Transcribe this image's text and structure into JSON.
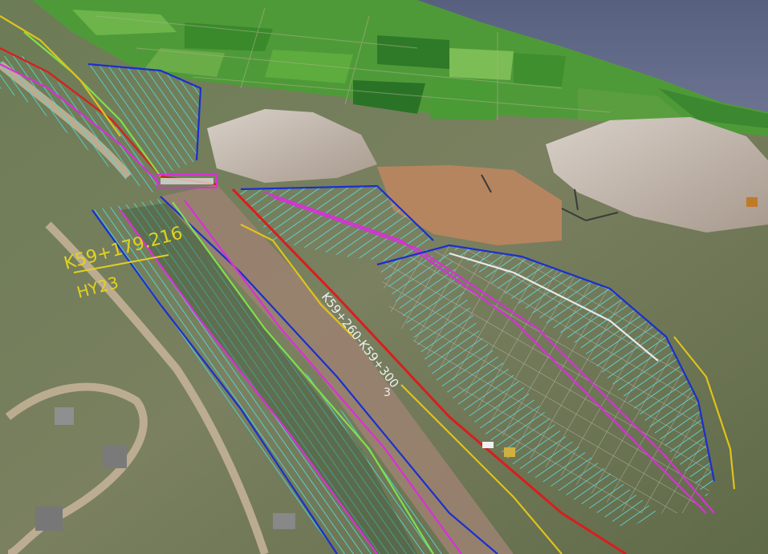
{
  "view": {
    "sky_color": "#5f6785",
    "farmland_colors": [
      "#3f8f2e",
      "#5aa63a",
      "#2f7a28",
      "#6fb34a",
      "#4c9a35"
    ],
    "slope_colors": {
      "cyan": "#4fd6d0",
      "magenta": "#d830d8",
      "blue": "#1a2fd0",
      "red": "#d81e1e",
      "yellow": "#e0c21a",
      "green": "#7ee04a",
      "white": "#e9e9e9"
    }
  },
  "annotations": {
    "station_label": "K59+179.216",
    "curve_label": "HY23",
    "range_label": "K59+260-K59+300",
    "note_mark": "3"
  }
}
